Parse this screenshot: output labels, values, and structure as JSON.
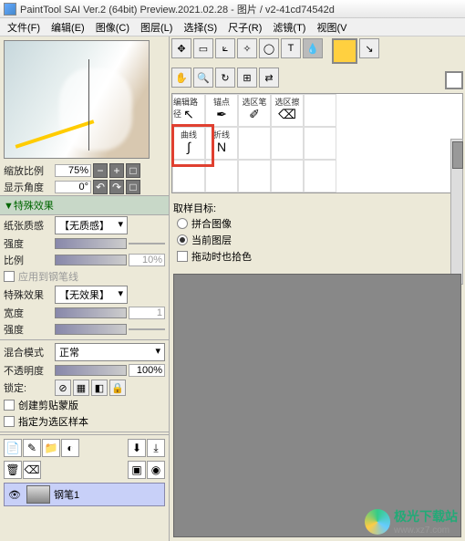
{
  "title": "PaintTool SAI Ver.2 (64bit) Preview.2021.02.28 - 图片 / v2-41cd74542d",
  "menu": [
    "文件(F)",
    "编辑(E)",
    "图像(C)",
    "图层(L)",
    "选择(S)",
    "尺子(R)",
    "滤镜(T)",
    "视图(V"
  ],
  "zoom": {
    "label": "缩放比例",
    "value": "75%"
  },
  "angle": {
    "label": "显示角度",
    "value": "0°"
  },
  "fx_header": "▼特殊效果",
  "paper": {
    "label": "纸张质感",
    "value": "【无质感】"
  },
  "intensity": {
    "label": "强度",
    "value": ""
  },
  "ratio": {
    "label": "比例",
    "value": "10%"
  },
  "apply_pen": "应用到钢笔线",
  "special": {
    "label": "特殊效果",
    "value": "【无效果】"
  },
  "width": {
    "label": "宽度",
    "value": "1"
  },
  "intensity2": {
    "label": "强度",
    "value": ""
  },
  "blend": {
    "label": "混合模式",
    "value": "正常"
  },
  "opacity": {
    "label": "不透明度",
    "value": "100%"
  },
  "lock": "锁定:",
  "clip": "创建剪贴蒙版",
  "sel_sample": "指定为选区样本",
  "layer_name": "钢笔1",
  "tools": {
    "row1_labels": [
      "编辑路径",
      "锚点",
      "选区笔",
      "选区擦"
    ],
    "row2_labels": [
      "曲线",
      "折线"
    ]
  },
  "sample_target": "取样目标:",
  "radio1": "拼合图像",
  "radio2": "当前图层",
  "chk_drag": "拖动时也拾色",
  "watermark": {
    "main": "极光下载站",
    "sub": "www.xz7.com"
  }
}
